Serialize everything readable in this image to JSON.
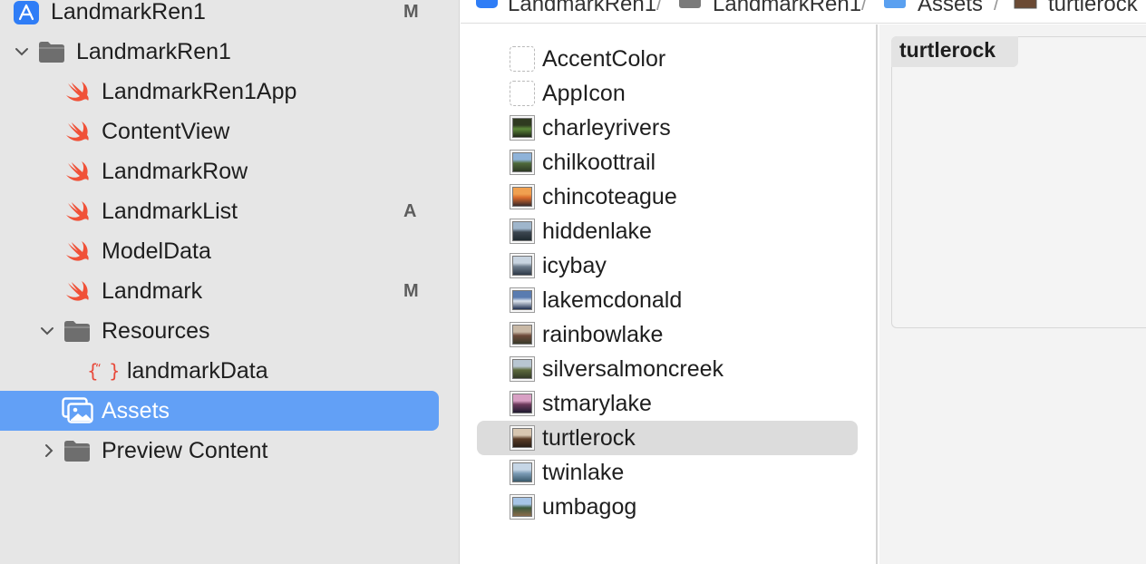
{
  "breadcrumb": {
    "items": [
      {
        "label": "LandmarkRen1",
        "icon": "app-icon"
      },
      {
        "label": "LandmarkRen1",
        "icon": "folder-icon"
      },
      {
        "label": "Assets",
        "icon": "asset-catalog-icon"
      },
      {
        "label": "turtlerock",
        "icon": "image-thumbnail-icon"
      }
    ],
    "separator": "/"
  },
  "navigator": {
    "project": {
      "label": "LandmarkRen1",
      "badge": "M",
      "icon": "app-icon"
    },
    "group": {
      "label": "LandmarkRen1",
      "icon": "folder-icon"
    },
    "files": [
      {
        "label": "LandmarkRen1App",
        "icon": "swift-icon",
        "badge": ""
      },
      {
        "label": "ContentView",
        "icon": "swift-icon",
        "badge": ""
      },
      {
        "label": "LandmarkRow",
        "icon": "swift-icon",
        "badge": ""
      },
      {
        "label": "LandmarkList",
        "icon": "swift-icon",
        "badge": "A"
      },
      {
        "label": "ModelData",
        "icon": "swift-icon",
        "badge": ""
      },
      {
        "label": "Landmark",
        "icon": "swift-icon",
        "badge": "M"
      }
    ],
    "resources": {
      "label": "Resources",
      "icon": "folder-icon",
      "child": {
        "label": "landmarkData",
        "icon": "json-icon"
      }
    },
    "assets": {
      "label": "Assets",
      "icon": "asset-catalog-icon"
    },
    "preview": {
      "label": "Preview Content",
      "icon": "folder-icon"
    }
  },
  "assets": {
    "items": [
      {
        "label": "AccentColor",
        "kind": "color"
      },
      {
        "label": "AppIcon",
        "kind": "appicon"
      },
      {
        "label": "charleyrivers",
        "kind": "image",
        "colors": [
          "#2f3a20",
          "#5d8a3a",
          "#1d2616"
        ]
      },
      {
        "label": "chilkoottrail",
        "kind": "image",
        "colors": [
          "#8fb3d9",
          "#4f6a3a",
          "#2d3a25"
        ]
      },
      {
        "label": "chincoteague",
        "kind": "image",
        "colors": [
          "#f0a050",
          "#d86a2c",
          "#3a2a2a"
        ]
      },
      {
        "label": "hiddenlake",
        "kind": "image",
        "colors": [
          "#9fb6cc",
          "#3c4650",
          "#1f2a30"
        ]
      },
      {
        "label": "icybay",
        "kind": "image",
        "colors": [
          "#c8d4e0",
          "#6c7c8c",
          "#2d3846"
        ]
      },
      {
        "label": "lakemcdonald",
        "kind": "image",
        "colors": [
          "#5a7cb0",
          "#dfe6ef",
          "#1f3050"
        ]
      },
      {
        "label": "rainbowlake",
        "kind": "image",
        "colors": [
          "#c9b9a6",
          "#6d4a3a",
          "#3a3a2a"
        ]
      },
      {
        "label": "silversalmoncreek",
        "kind": "image",
        "colors": [
          "#b8c6d2",
          "#5d6a3c",
          "#333a26"
        ]
      },
      {
        "label": "stmarylake",
        "kind": "image",
        "colors": [
          "#d8a0c4",
          "#6c3a5c",
          "#1f1a30"
        ]
      },
      {
        "label": "turtlerock",
        "kind": "image",
        "colors": [
          "#d8c6b0",
          "#5a3c26",
          "#2a1e16"
        ],
        "selected": true
      },
      {
        "label": "twinlake",
        "kind": "image",
        "colors": [
          "#c6d6e6",
          "#7c9cb6",
          "#3a5a6c"
        ]
      },
      {
        "label": "umbagog",
        "kind": "image",
        "colors": [
          "#a6c4e6",
          "#3c5a3c",
          "#8a6a4a"
        ]
      }
    ]
  },
  "detail": {
    "title": "turtlerock"
  }
}
